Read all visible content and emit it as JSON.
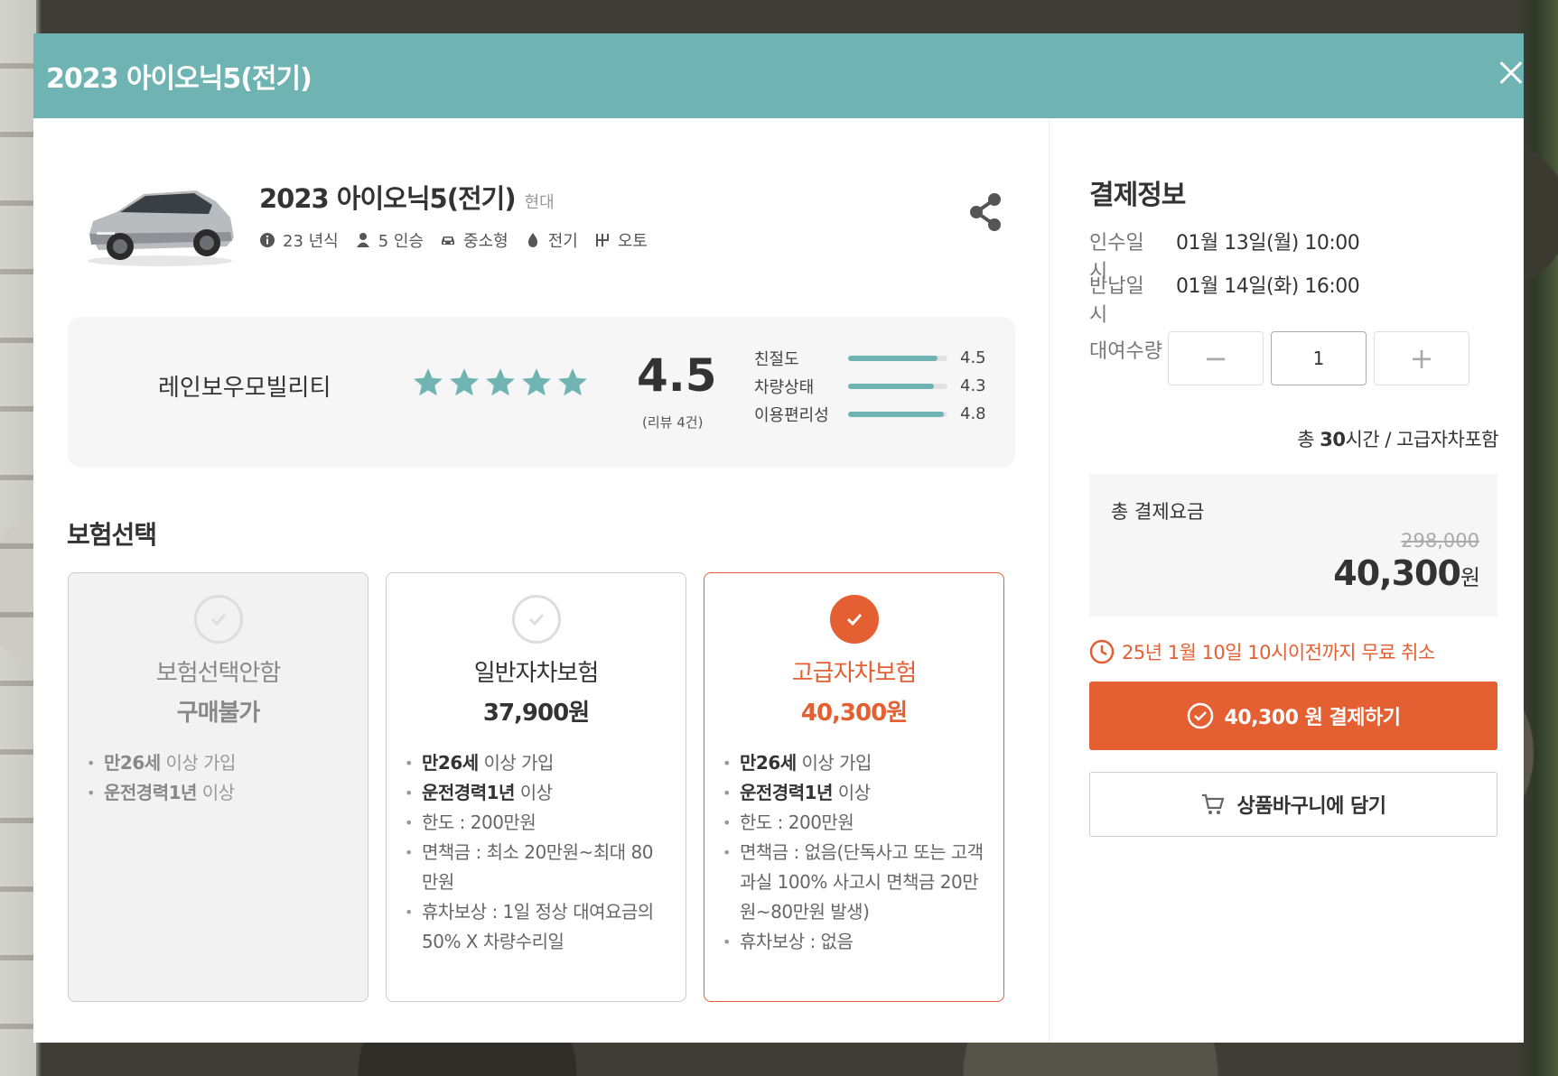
{
  "modal": {
    "title": "2023 아이오닉5(전기)"
  },
  "car": {
    "name": "2023 아이오닉5(전기)",
    "brand": "현대",
    "specs": [
      {
        "icon": "info-icon",
        "label": "23 년식"
      },
      {
        "icon": "person-icon",
        "label": "5 인승"
      },
      {
        "icon": "car-icon",
        "label": "중소형"
      },
      {
        "icon": "drop-icon",
        "label": "전기"
      },
      {
        "icon": "gear-shift-icon",
        "label": "오토"
      }
    ]
  },
  "rating": {
    "company": "레인보우모빌리티",
    "score": "4.5",
    "stars": 5,
    "review_count": "(리뷰 4건)",
    "star_color": "#6fb4b3",
    "categories": [
      {
        "label": "친절도",
        "value": "4.5",
        "fraction": 0.9
      },
      {
        "label": "차량상태",
        "value": "4.3",
        "fraction": 0.86
      },
      {
        "label": "이용편리성",
        "value": "4.8",
        "fraction": 0.96
      }
    ]
  },
  "insurance": {
    "title": "보험선택",
    "cards": [
      {
        "name": "보험선택안함",
        "price": "구매불가",
        "features": [
          {
            "bold": "만26세",
            "text": " 이상 가입"
          },
          {
            "bold": "운전경력1년",
            "text": " 이상"
          }
        ]
      },
      {
        "name": "일반자차보험",
        "price": "37,900원",
        "features": [
          {
            "bold": "만26세",
            "text": " 이상 가입"
          },
          {
            "bold": "운전경력1년",
            "text": " 이상"
          },
          {
            "bold": "",
            "text": "한도 : 200만원"
          },
          {
            "bold": "",
            "text": "면책금 : 최소 20만원~최대 80만원"
          },
          {
            "bold": "",
            "text": "휴차보상 : 1일 정상 대여요금의 50% X 차량수리일"
          }
        ]
      },
      {
        "name": "고급자차보험",
        "price": "40,300원",
        "features": [
          {
            "bold": "만26세",
            "text": " 이상 가입"
          },
          {
            "bold": "운전경력1년",
            "text": " 이상"
          },
          {
            "bold": "",
            "text": "한도 : 200만원"
          },
          {
            "bold": "",
            "text": "면책금 : 없음(단독사고 또는 고객과실 100% 사고시 면책금 20만원~80만원 발생)"
          },
          {
            "bold": "",
            "text": "휴차보상 : 없음"
          }
        ]
      }
    ]
  },
  "payment": {
    "title": "결제정보",
    "pickup_label": "인수일시",
    "pickup_value": "01월 13일(월) 10:00",
    "return_label": "반납일시",
    "return_value": "01월 14일(화) 16:00",
    "qty_label": "대여수량",
    "qty_minus": "−",
    "qty_value": "1",
    "qty_plus": "+",
    "total_hours_prefix": "총 ",
    "total_hours_value": "30",
    "total_hours_suffix": "시간 / 고급자차포함",
    "total_label": "총 결제요금",
    "old_price": "298,000",
    "new_price": "40,300",
    "currency": "원",
    "cancel_notice": "25년 1월 10일 10시이전까지 무료 취소",
    "pay_button": "40,300 원 결제하기",
    "cart_button": "상품바구니에 담기",
    "accent_color": "#e45f32"
  }
}
